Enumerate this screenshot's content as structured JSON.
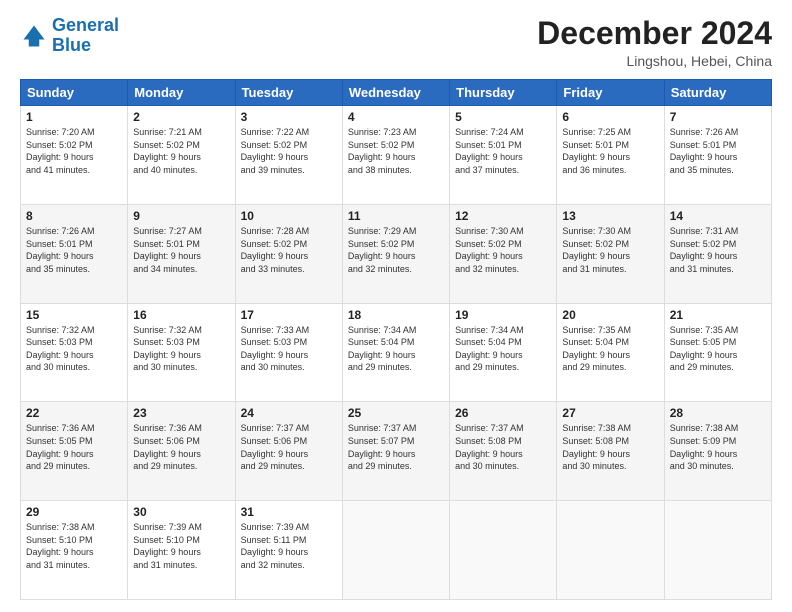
{
  "logo": {
    "line1": "General",
    "line2": "Blue"
  },
  "title": "December 2024",
  "location": "Lingshou, Hebei, China",
  "days_header": [
    "Sunday",
    "Monday",
    "Tuesday",
    "Wednesday",
    "Thursday",
    "Friday",
    "Saturday"
  ],
  "weeks": [
    [
      {
        "day": "1",
        "info": "Sunrise: 7:20 AM\nSunset: 5:02 PM\nDaylight: 9 hours\nand 41 minutes."
      },
      {
        "day": "2",
        "info": "Sunrise: 7:21 AM\nSunset: 5:02 PM\nDaylight: 9 hours\nand 40 minutes."
      },
      {
        "day": "3",
        "info": "Sunrise: 7:22 AM\nSunset: 5:02 PM\nDaylight: 9 hours\nand 39 minutes."
      },
      {
        "day": "4",
        "info": "Sunrise: 7:23 AM\nSunset: 5:02 PM\nDaylight: 9 hours\nand 38 minutes."
      },
      {
        "day": "5",
        "info": "Sunrise: 7:24 AM\nSunset: 5:01 PM\nDaylight: 9 hours\nand 37 minutes."
      },
      {
        "day": "6",
        "info": "Sunrise: 7:25 AM\nSunset: 5:01 PM\nDaylight: 9 hours\nand 36 minutes."
      },
      {
        "day": "7",
        "info": "Sunrise: 7:26 AM\nSunset: 5:01 PM\nDaylight: 9 hours\nand 35 minutes."
      }
    ],
    [
      {
        "day": "8",
        "info": "Sunrise: 7:26 AM\nSunset: 5:01 PM\nDaylight: 9 hours\nand 35 minutes."
      },
      {
        "day": "9",
        "info": "Sunrise: 7:27 AM\nSunset: 5:01 PM\nDaylight: 9 hours\nand 34 minutes."
      },
      {
        "day": "10",
        "info": "Sunrise: 7:28 AM\nSunset: 5:02 PM\nDaylight: 9 hours\nand 33 minutes."
      },
      {
        "day": "11",
        "info": "Sunrise: 7:29 AM\nSunset: 5:02 PM\nDaylight: 9 hours\nand 32 minutes."
      },
      {
        "day": "12",
        "info": "Sunrise: 7:30 AM\nSunset: 5:02 PM\nDaylight: 9 hours\nand 32 minutes."
      },
      {
        "day": "13",
        "info": "Sunrise: 7:30 AM\nSunset: 5:02 PM\nDaylight: 9 hours\nand 31 minutes."
      },
      {
        "day": "14",
        "info": "Sunrise: 7:31 AM\nSunset: 5:02 PM\nDaylight: 9 hours\nand 31 minutes."
      }
    ],
    [
      {
        "day": "15",
        "info": "Sunrise: 7:32 AM\nSunset: 5:03 PM\nDaylight: 9 hours\nand 30 minutes."
      },
      {
        "day": "16",
        "info": "Sunrise: 7:32 AM\nSunset: 5:03 PM\nDaylight: 9 hours\nand 30 minutes."
      },
      {
        "day": "17",
        "info": "Sunrise: 7:33 AM\nSunset: 5:03 PM\nDaylight: 9 hours\nand 30 minutes."
      },
      {
        "day": "18",
        "info": "Sunrise: 7:34 AM\nSunset: 5:04 PM\nDaylight: 9 hours\nand 29 minutes."
      },
      {
        "day": "19",
        "info": "Sunrise: 7:34 AM\nSunset: 5:04 PM\nDaylight: 9 hours\nand 29 minutes."
      },
      {
        "day": "20",
        "info": "Sunrise: 7:35 AM\nSunset: 5:04 PM\nDaylight: 9 hours\nand 29 minutes."
      },
      {
        "day": "21",
        "info": "Sunrise: 7:35 AM\nSunset: 5:05 PM\nDaylight: 9 hours\nand 29 minutes."
      }
    ],
    [
      {
        "day": "22",
        "info": "Sunrise: 7:36 AM\nSunset: 5:05 PM\nDaylight: 9 hours\nand 29 minutes."
      },
      {
        "day": "23",
        "info": "Sunrise: 7:36 AM\nSunset: 5:06 PM\nDaylight: 9 hours\nand 29 minutes."
      },
      {
        "day": "24",
        "info": "Sunrise: 7:37 AM\nSunset: 5:06 PM\nDaylight: 9 hours\nand 29 minutes."
      },
      {
        "day": "25",
        "info": "Sunrise: 7:37 AM\nSunset: 5:07 PM\nDaylight: 9 hours\nand 29 minutes."
      },
      {
        "day": "26",
        "info": "Sunrise: 7:37 AM\nSunset: 5:08 PM\nDaylight: 9 hours\nand 30 minutes."
      },
      {
        "day": "27",
        "info": "Sunrise: 7:38 AM\nSunset: 5:08 PM\nDaylight: 9 hours\nand 30 minutes."
      },
      {
        "day": "28",
        "info": "Sunrise: 7:38 AM\nSunset: 5:09 PM\nDaylight: 9 hours\nand 30 minutes."
      }
    ],
    [
      {
        "day": "29",
        "info": "Sunrise: 7:38 AM\nSunset: 5:10 PM\nDaylight: 9 hours\nand 31 minutes."
      },
      {
        "day": "30",
        "info": "Sunrise: 7:39 AM\nSunset: 5:10 PM\nDaylight: 9 hours\nand 31 minutes."
      },
      {
        "day": "31",
        "info": "Sunrise: 7:39 AM\nSunset: 5:11 PM\nDaylight: 9 hours\nand 32 minutes."
      },
      {
        "day": "",
        "info": ""
      },
      {
        "day": "",
        "info": ""
      },
      {
        "day": "",
        "info": ""
      },
      {
        "day": "",
        "info": ""
      }
    ]
  ]
}
